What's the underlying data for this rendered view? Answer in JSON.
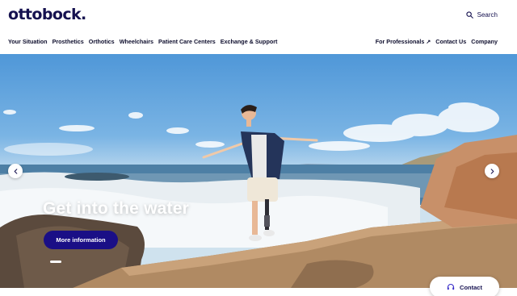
{
  "brand": {
    "logo": "ottobock."
  },
  "search": {
    "label": "Search",
    "icon": "search-icon"
  },
  "nav": {
    "left": [
      "Your Situation",
      "Prosthetics",
      "Orthotics",
      "Wheelchairs",
      "Patient Care Centers",
      "Exchange & Support"
    ],
    "right": {
      "professionals": "For Professionals",
      "professionals_icon": "external-link-icon",
      "contact": "Contact Us",
      "company": "Company"
    }
  },
  "hero": {
    "eyebrow": "",
    "title": "Get into the water",
    "cta": "More information",
    "slide_count": 1,
    "active_slide": 1
  },
  "contact_button": {
    "label": "Contact",
    "icon": "headset-icon"
  },
  "colors": {
    "brand": "#15114f",
    "cta": "#1a0f86",
    "text": "#0f0f2e"
  }
}
